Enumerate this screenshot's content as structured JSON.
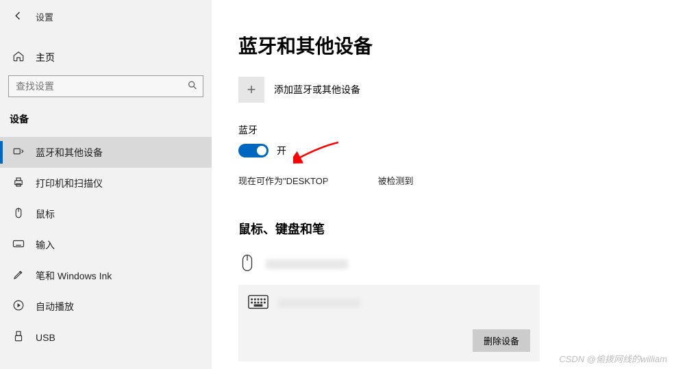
{
  "app_title": "设置",
  "home_label": "主页",
  "search_placeholder": "查找设置",
  "section_header": "设备",
  "nav": [
    {
      "label": "蓝牙和其他设备",
      "active": true,
      "icon": "bluetooth"
    },
    {
      "label": "打印机和扫描仪",
      "active": false,
      "icon": "printer"
    },
    {
      "label": "鼠标",
      "active": false,
      "icon": "mouse"
    },
    {
      "label": "输入",
      "active": false,
      "icon": "keyboard"
    },
    {
      "label": "笔和 Windows Ink",
      "active": false,
      "icon": "pen"
    },
    {
      "label": "自动播放",
      "active": false,
      "icon": "autoplay"
    },
    {
      "label": "USB",
      "active": false,
      "icon": "usb"
    }
  ],
  "page_title": "蓝牙和其他设备",
  "add_device_label": "添加蓝牙或其他设备",
  "bluetooth_label": "蓝牙",
  "toggle_state": "开",
  "discover_prefix": "现在可作为\"DESKTOP",
  "discover_suffix": "被检测到",
  "group_title": "鼠标、键盘和笔",
  "remove_button": "删除设备",
  "watermark": "CSDN @偷拨网线的william",
  "colors": {
    "accent": "#0067c0"
  }
}
